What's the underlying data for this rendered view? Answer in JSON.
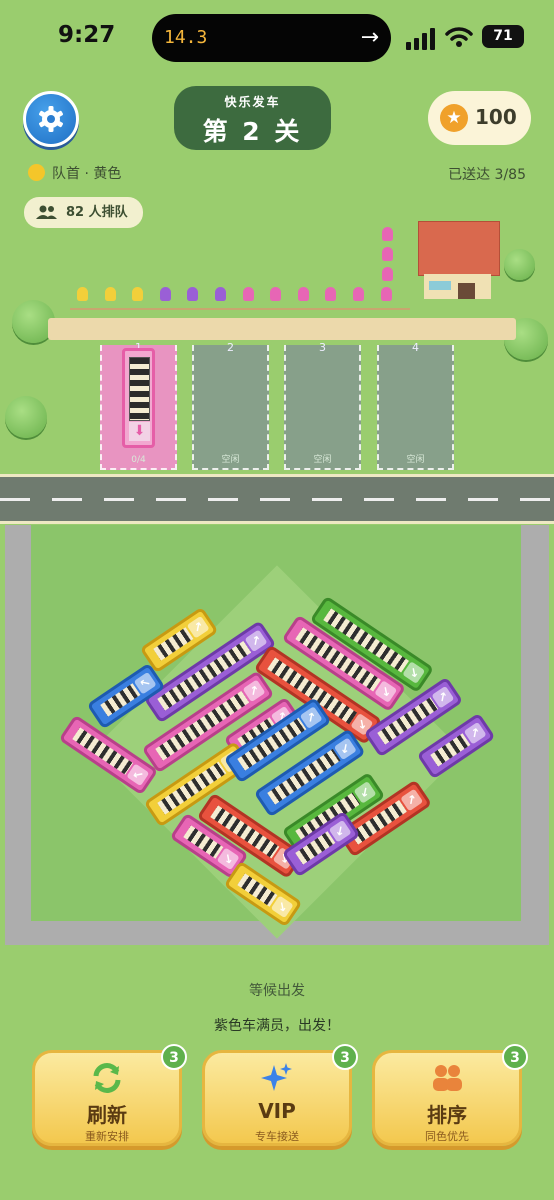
{
  "status_bar": {
    "time": "9:27",
    "island_text": "14.3",
    "battery": "71"
  },
  "header": {
    "level_subtitle": "快乐发车",
    "level_title": "第 2 关",
    "coins": "100",
    "queue_head": "队首 · 黄色",
    "delivered": "已送达 3/85",
    "queue_count": "82 人排队"
  },
  "parking_slots": [
    {
      "number": "1",
      "label": "0/4",
      "occupied": true,
      "color": "#e55ea7"
    },
    {
      "number": "2",
      "label": "空闲",
      "occupied": false
    },
    {
      "number": "3",
      "label": "空闲",
      "occupied": false
    },
    {
      "number": "4",
      "label": "空闲",
      "occupied": false
    }
  ],
  "queue_colors": [
    "yellow",
    "yellow",
    "yellow",
    "purple",
    "purple",
    "purple",
    "pink",
    "pink",
    "pink",
    "pink",
    "pink",
    "pink",
    "pink",
    "pink",
    "pink"
  ],
  "status": {
    "waiting": "等候出发",
    "message": "紫色车满员，出发！"
  },
  "actions": [
    {
      "label": "刷新",
      "caption": "重新安排",
      "count": "3",
      "icon": "refresh-icon"
    },
    {
      "label": "VIP",
      "caption": "专车接送",
      "count": "3",
      "icon": "sparkle-icon"
    },
    {
      "label": "排序",
      "caption": "同色优先",
      "count": "3",
      "icon": "people-icon"
    }
  ],
  "colors": {
    "yellow": "#f2cf3a",
    "purple": "#9a5fd6",
    "pink": "#e766b5",
    "blue": "#3a7fe0",
    "red": "#e8523e",
    "green": "#58b83e"
  }
}
